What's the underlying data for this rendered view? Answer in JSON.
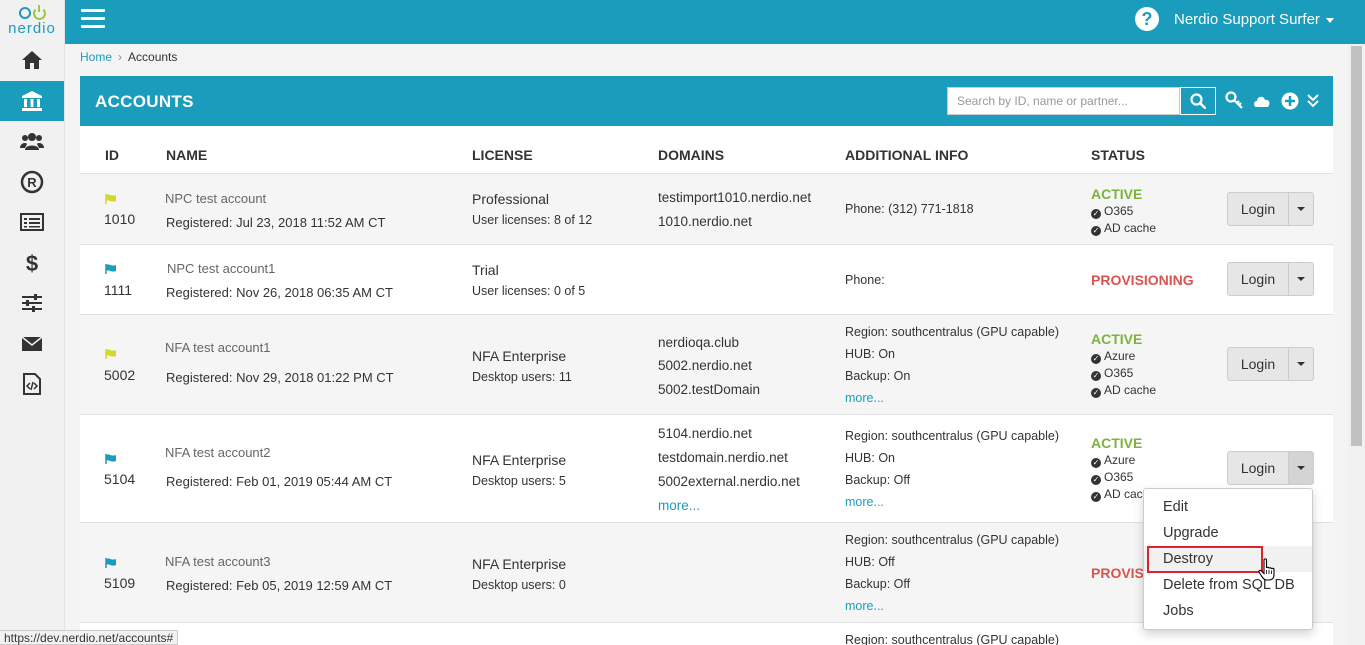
{
  "brand": {
    "logo_text": "nerdio",
    "colors": {
      "primary": "#1a9cbc",
      "accent": "#a0c846",
      "active": "#7cb33e",
      "provisioning": "#d9534f"
    }
  },
  "sidebar": {
    "items": [
      {
        "name": "home",
        "icon": "home-icon"
      },
      {
        "name": "accounts",
        "icon": "bank-icon",
        "active": true
      },
      {
        "name": "users",
        "icon": "users-icon"
      },
      {
        "name": "registered",
        "icon": "registered-icon"
      },
      {
        "name": "list",
        "icon": "list-icon"
      },
      {
        "name": "billing",
        "icon": "dollar-icon"
      },
      {
        "name": "settings",
        "icon": "sliders-icon"
      },
      {
        "name": "messages",
        "icon": "envelope-icon"
      },
      {
        "name": "scripts",
        "icon": "code-file-icon"
      }
    ]
  },
  "topbar": {
    "user_menu_label": "Nerdio Support Surfer",
    "help_glyph": "?"
  },
  "breadcrumb": {
    "home": "Home",
    "separator": "›",
    "current": "Accounts"
  },
  "panel": {
    "title": "ACCOUNTS",
    "search_placeholder": "Search by ID, name or partner..."
  },
  "table": {
    "columns": {
      "id": "ID",
      "name": "NAME",
      "license": "LICENSE",
      "domains": "DOMAINS",
      "additional_info": "ADDITIONAL INFO",
      "status": "STATUS"
    },
    "login_label": "Login",
    "rows": [
      {
        "id": "1010",
        "flag_color": "#d4d82a",
        "name": "NPC test account",
        "registered": "Registered: Jul 23, 2018 11:52 AM CT",
        "license": "Professional",
        "license_sub": "User licenses: 8 of 12",
        "domains": [
          "testimport1010.nerdio.net",
          "1010.nerdio.net"
        ],
        "info": [
          "Phone: (312) 771-1818"
        ],
        "status": "ACTIVE",
        "checks": [
          "O365",
          "AD cache"
        ]
      },
      {
        "id": "1111",
        "flag_color": "#1a9cbc",
        "name": "NPC test account1",
        "registered": "Registered: Nov 26, 2018 06:35 AM CT",
        "license": "Trial",
        "license_sub": "User licenses: 0 of 5",
        "domains": [],
        "info": [
          "Phone:"
        ],
        "status": "PROVISIONING",
        "checks": []
      },
      {
        "id": "5002",
        "flag_color": "#d4d82a",
        "name": "NFA test account1",
        "registered": "Registered: Nov 29, 2018 01:22 PM CT",
        "license": "NFA Enterprise",
        "license_sub": "Desktop users: 11",
        "domains": [
          "nerdioqa.club",
          "5002.nerdio.net",
          "5002.testDomain"
        ],
        "info": [
          "Region: southcentralus (GPU capable)",
          "HUB: On",
          "Backup: On"
        ],
        "info_more": "more...",
        "status": "ACTIVE",
        "checks": [
          "Azure",
          "O365",
          "AD cache"
        ]
      },
      {
        "id": "5104",
        "flag_color": "#1a9cbc",
        "name": "NFA test account2",
        "registered": "Registered: Feb 01, 2019 05:44 AM CT",
        "license": "NFA Enterprise",
        "license_sub": "Desktop users: 5",
        "domains": [
          "5104.nerdio.net",
          "testdomain.nerdio.net",
          "5002external.nerdio.net"
        ],
        "domains_more": "more...",
        "info": [
          "Region: southcentralus (GPU capable)",
          "HUB: On",
          "Backup: Off"
        ],
        "info_more": "more...",
        "status": "ACTIVE",
        "checks": [
          "Azure",
          "O365",
          "AD cac"
        ]
      },
      {
        "id": "5109",
        "flag_color": "#1a9cbc",
        "name": "NFA test account3",
        "registered": "Registered: Feb 05, 2019 12:59 AM CT",
        "license": "NFA Enterprise",
        "license_sub": "Desktop users: 0",
        "domains": [],
        "info": [
          "Region: southcentralus (GPU capable)",
          "HUB: Off",
          "Backup: Off"
        ],
        "info_more": "more...",
        "status": "PROVIS",
        "checks": []
      },
      {
        "info": [
          "Region: southcentralus (GPU capable)"
        ]
      }
    ]
  },
  "dropdown": {
    "items": [
      "Edit",
      "Upgrade",
      "Destroy",
      "Delete from SQL DB",
      "Jobs"
    ],
    "highlighted": "Destroy"
  },
  "statusbar": {
    "url": "https://dev.nerdio.net/accounts#"
  }
}
